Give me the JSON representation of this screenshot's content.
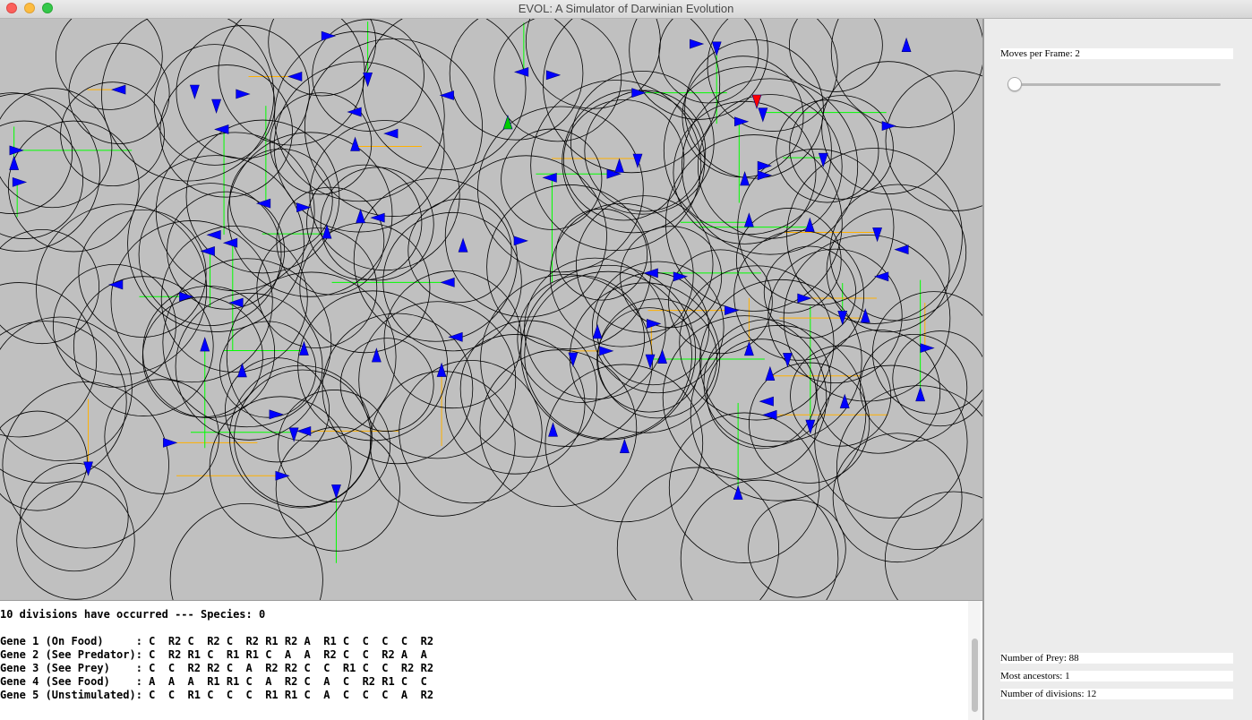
{
  "window": {
    "title": "EVOL: A Simulator of Darwinian Evolution"
  },
  "colors": {
    "canvas_bg": "#c0c0c0",
    "circle": "#000000",
    "prey": "#0000ff",
    "predator": "#ff0000",
    "food": "#00cc00",
    "path_green": "#00ff00",
    "path_orange": "#ffb000"
  },
  "log": {
    "summary": "10 divisions have occurred --- Species: 0",
    "genes": [
      "Gene 1 (On Food)     : C  R2 C  R2 C  R2 R1 R2 A  R1 C  C  C  C  R2",
      "Gene 2 (See Predator): C  R2 R1 C  R1 R1 C  A  A  R2 C  C  R2 A  A",
      "Gene 3 (See Prey)    : C  C  R2 R2 C  A  R2 R2 C  C  R1 C  C  R2 R2",
      "Gene 4 (See Food)    : A  A  A  R1 R1 C  A  R2 C  A  C  R2 R1 C  C",
      "Gene 5 (Unstimulated): C  C  R1 C  C  C  R1 R1 C  A  C  C  C  A  R2"
    ]
  },
  "controls": {
    "moves_per_frame_label": "Moves per Frame: 2",
    "moves_per_frame": 2
  },
  "stats": {
    "prey_label": "Number of Prey: 88",
    "ancestors_label": "Most ancestors: 1",
    "divisions_label": "Number of divisions: 12"
  }
}
